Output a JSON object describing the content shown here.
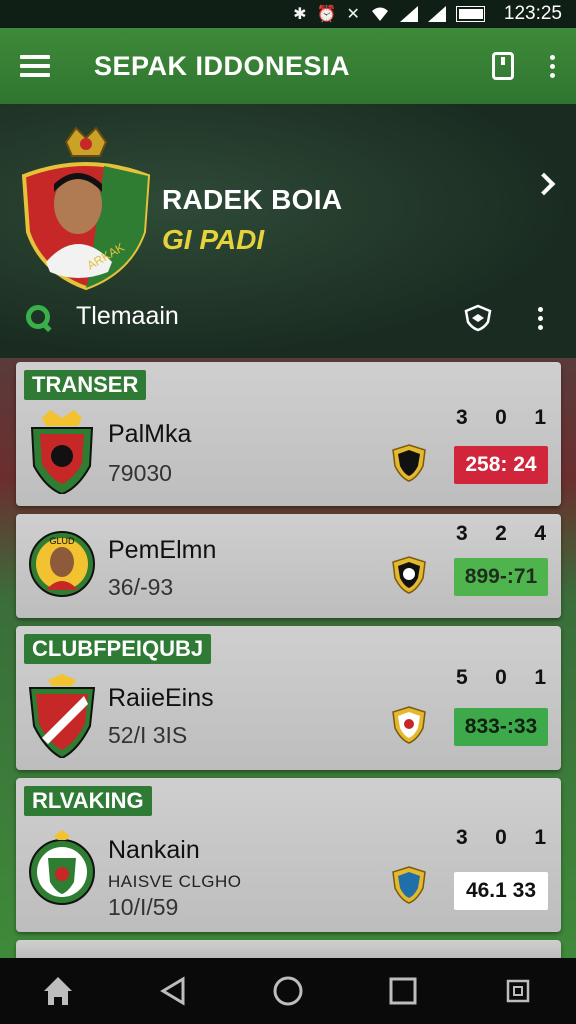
{
  "status_bar": {
    "time": "123:25",
    "icons": [
      "bluetooth-icon",
      "alarm-icon",
      "no-signal-icon",
      "wifi-icon",
      "signal-icon",
      "signal-icon",
      "battery-icon"
    ]
  },
  "app_bar": {
    "title": "SEPAK IDDONESIA",
    "icons": [
      "menu-icon",
      "phone-icon",
      "more-icon"
    ]
  },
  "hero": {
    "player_name": "RADEK BOIA",
    "player_sub": "GI PADI",
    "search_label": "Tlemaain"
  },
  "cards": [
    {
      "tag": "TRANSER",
      "team_name": "PalMka",
      "stat": "79030",
      "extra": "",
      "nums": [
        "3",
        "0",
        "1"
      ],
      "score": "258: 24",
      "score_color": "red",
      "badge_colors": [
        "#c62828",
        "#2e7d32",
        "#f2c230"
      ]
    },
    {
      "tag": "",
      "team_name": "PemElmn",
      "stat": "36/-93",
      "extra": "",
      "badge_text": "GLUD",
      "nums": [
        "3",
        "2",
        "4"
      ],
      "score": "899-:71",
      "score_color": "green",
      "badge_colors": [
        "#2e7d32",
        "#f2c230",
        "#c62828"
      ]
    },
    {
      "tag": "CLUBFPEIQUBJ",
      "team_name": "RaiieEins",
      "stat": "52/I 3IS",
      "extra": "",
      "nums": [
        "5",
        "0",
        "1"
      ],
      "score": "833-:33",
      "score_color": "green2",
      "badge_colors": [
        "#c62828",
        "#ffffff",
        "#2e7d32"
      ]
    },
    {
      "tag": "RLVAKING",
      "team_name": "Nankain",
      "stat": "10/I/59",
      "extra": "HAISVE CLGHO",
      "nums": [
        "3",
        "0",
        "1"
      ],
      "score": "46.1  33",
      "score_color": "white",
      "badge_colors": [
        "#2e7d32",
        "#ffffff",
        "#c62828"
      ]
    }
  ],
  "bottom_nav": {
    "icons": [
      "home-icon",
      "back-icon",
      "home-circle-icon",
      "recents-icon",
      "screenshot-icon"
    ]
  }
}
